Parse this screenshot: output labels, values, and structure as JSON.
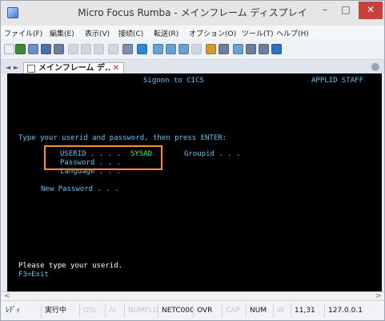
{
  "window": {
    "title": "Micro Focus Rumba - メインフレーム ディスプレイ",
    "min_glyph": "–",
    "max_glyph": "□",
    "close_glyph": "✕"
  },
  "menu": [
    {
      "label": "ファイル(F)"
    },
    {
      "label": "編集(E)"
    },
    {
      "label": "表示(V)"
    },
    {
      "label": "接続(C)"
    },
    {
      "label": "転送(R)"
    },
    {
      "label": "オプション(O)"
    },
    {
      "label": "ツール(T)"
    },
    {
      "label": "ヘルプ(H)"
    }
  ],
  "toolbar": [
    {
      "icon": "new-icon",
      "color": "#e6eef8"
    },
    {
      "icon": "arrow-icon",
      "color": "#3a8a3a"
    },
    {
      "icon": "screen-icon",
      "color": "#6a90c8"
    },
    {
      "icon": "save-icon",
      "color": "#4b6fa8"
    },
    {
      "icon": "print-icon",
      "color": "#6f7f9a"
    },
    {
      "icon": "cut-icon",
      "color": "#b0b6c2",
      "dim": true
    },
    {
      "icon": "copy-icon",
      "color": "#b0b6c2",
      "dim": true
    },
    {
      "icon": "paste-icon",
      "color": "#b0b6c2",
      "dim": true
    },
    {
      "icon": "undo-icon",
      "color": "#b0b6c2",
      "dim": true
    },
    {
      "icon": "edit-icon",
      "color": "#7b8fb0"
    },
    {
      "icon": "connect-icon",
      "color": "#2e88d8"
    },
    {
      "icon": "send-icon",
      "color": "#6aa0d8"
    },
    {
      "icon": "receive-icon",
      "color": "#6aa0d8"
    },
    {
      "icon": "transfer-icon",
      "color": "#6aa0d8"
    },
    {
      "icon": "record-icon",
      "color": "#b0b6c2",
      "dim": true
    },
    {
      "icon": "macro-icon",
      "color": "#d39a2a"
    },
    {
      "icon": "keyboard-icon",
      "color": "#6f7f9a"
    },
    {
      "icon": "hotspot-icon",
      "color": "#6aa0d8"
    },
    {
      "icon": "settings-icon",
      "color": "#6f7f9a"
    },
    {
      "icon": "map-icon",
      "color": "#6f7f9a"
    },
    {
      "icon": "help-icon",
      "color": "#2e6fc8"
    }
  ],
  "tab": {
    "label": "メインフレーム デ..",
    "close_glyph": "✕",
    "nav_prev": "◄",
    "nav_next": "►"
  },
  "terminal": {
    "title": "Signon to CICS",
    "applid": "APPLID STAFF",
    "instruction": "Type your userid and password, then press ENTER:",
    "userid_label": "USERID . . . .",
    "userid_value": "SYSAD",
    "groupid_label": "Groupid . . .",
    "password_label": "Password . . .",
    "language_label": "Language . . .",
    "newpw_label": "New Password . . .",
    "message": "Please type your userid.",
    "pfkey": "F3=Exit"
  },
  "scroll": {
    "left": "<",
    "right": ">"
  },
  "status": [
    {
      "label": "ﾚﾃﾞｨ",
      "dim": false
    },
    {
      "label": "実行中",
      "dim": false
    },
    {
      "label": "OSL",
      "dim": true
    },
    {
      "label": "AI",
      "dim": true
    },
    {
      "label": "NUMFLD",
      "dim": true
    },
    {
      "label": "NETC000",
      "dim": false
    },
    {
      "label": "OVR",
      "dim": false
    },
    {
      "label": "CAP",
      "dim": true
    },
    {
      "label": "NUM",
      "dim": false
    },
    {
      "label": "W",
      "dim": true
    },
    {
      "label": "11,31",
      "dim": false
    },
    {
      "label": "127.0.0.1",
      "dim": false
    }
  ]
}
